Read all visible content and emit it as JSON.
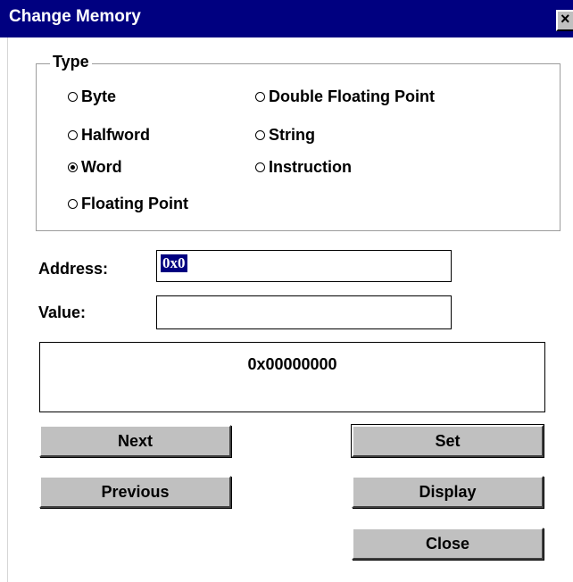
{
  "window": {
    "title": "Change Memory",
    "close_glyph": "×"
  },
  "type_group": {
    "legend": "Type",
    "options": [
      {
        "label": "Byte",
        "checked": false
      },
      {
        "label": "Halfword",
        "checked": false
      },
      {
        "label": "Word",
        "checked": true
      },
      {
        "label": "Floating Point",
        "checked": false
      },
      {
        "label": "Double Floating Point",
        "checked": false
      },
      {
        "label": "String",
        "checked": false
      },
      {
        "label": "Instruction",
        "checked": false
      }
    ]
  },
  "address": {
    "label": "Address:",
    "value": "0x0"
  },
  "value": {
    "label": "Value:",
    "value": ""
  },
  "display": {
    "text": "0x00000000"
  },
  "buttons": {
    "next": "Next",
    "previous": "Previous",
    "set": "Set",
    "display": "Display",
    "close": "Close"
  },
  "colors": {
    "titlebar": "#000080",
    "button_face": "#c0c0c0",
    "selection": "#000080"
  }
}
